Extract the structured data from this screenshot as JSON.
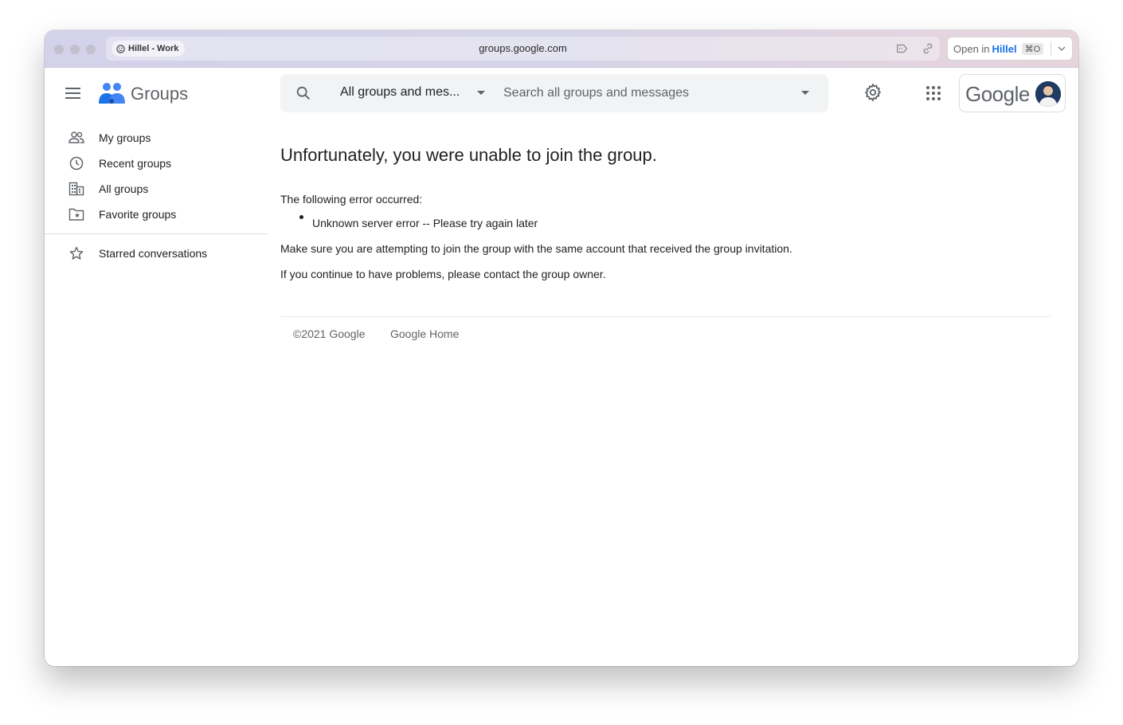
{
  "browser": {
    "profile_label": "Hillel - Work",
    "url": "groups.google.com",
    "open_in_prefix": "Open in",
    "open_in_target": "Hillel",
    "open_in_shortcut": "⌘O"
  },
  "app": {
    "name": "Groups",
    "account_brand": "Google"
  },
  "search": {
    "scope_label": "All groups and mes...",
    "placeholder": "Search all groups and messages"
  },
  "sidebar": {
    "items": [
      {
        "label": "My groups",
        "icon": "people-icon"
      },
      {
        "label": "Recent groups",
        "icon": "clock-icon"
      },
      {
        "label": "All groups",
        "icon": "building-icon"
      },
      {
        "label": "Favorite groups",
        "icon": "star-folder-icon"
      },
      {
        "label": "Starred conversations",
        "icon": "star-icon"
      }
    ]
  },
  "main": {
    "heading": "Unfortunately, you were unable to join the group.",
    "error_intro": "The following error occurred:",
    "error_item": "Unknown server error -- Please try again later",
    "advice_1": "Make sure you are attempting to join the group with the same account that received the group invitation.",
    "advice_2": "If you continue to have problems, please contact the group owner."
  },
  "footer": {
    "copyright": "©2021 Google",
    "home_link": "Google Home"
  },
  "colors": {
    "brand_blue": "#1a73e8",
    "text_primary": "#202124",
    "text_secondary": "#5f6368"
  }
}
